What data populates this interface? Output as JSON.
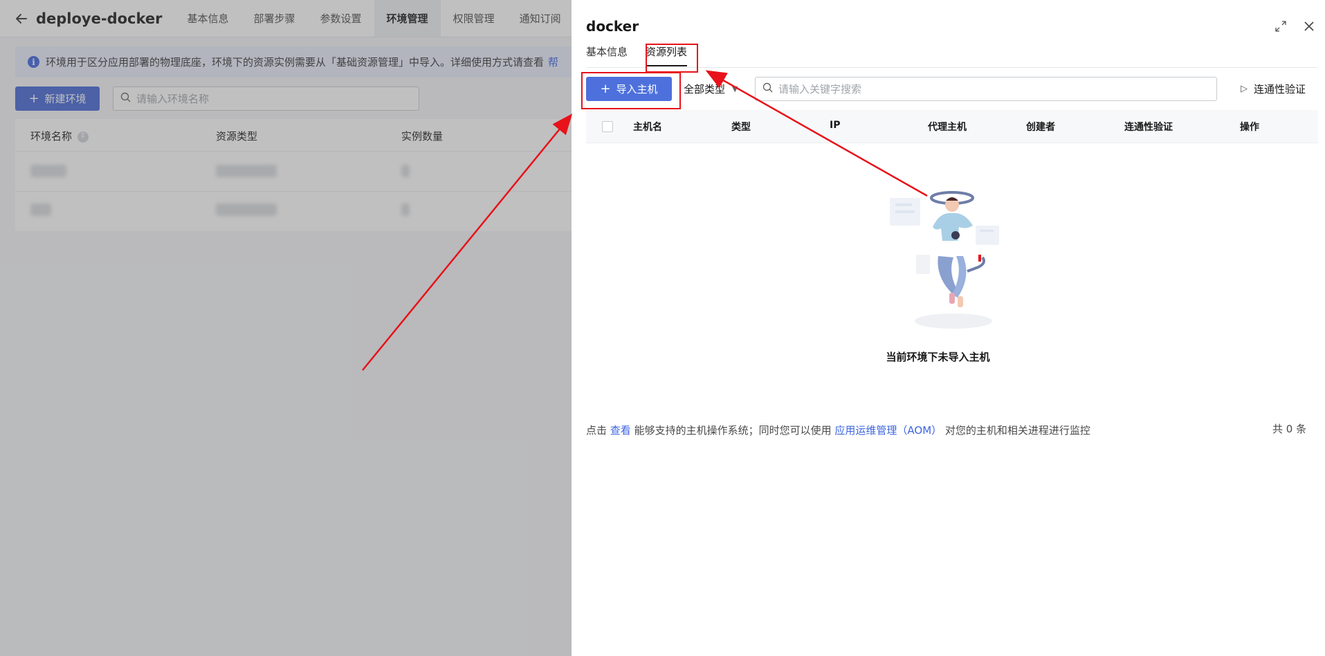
{
  "app": {
    "title": "deploye-docker"
  },
  "top_tabs": [
    {
      "label": "基本信息"
    },
    {
      "label": "部署步骤"
    },
    {
      "label": "参数设置"
    },
    {
      "label": "环境管理"
    },
    {
      "label": "权限管理"
    },
    {
      "label": "通知订阅"
    }
  ],
  "info_bar": {
    "text": "环境用于区分应用部署的物理底座，环境下的资源实例需要从「基础资源管理」中导入。详细使用方式请查看",
    "link": "帮"
  },
  "env_toolbar": {
    "new_env_label": "新建环境",
    "search_placeholder": "请输入环境名称"
  },
  "env_table": {
    "columns": [
      "环境名称",
      "资源类型",
      "实例数量"
    ]
  },
  "drawer": {
    "title": "docker",
    "tabs": [
      {
        "label": "基本信息"
      },
      {
        "label": "资源列表"
      }
    ],
    "import_label": "导入主机",
    "type_select": "全部类型",
    "search_placeholder": "请输入关键字搜索",
    "conn_label": "连通性验证",
    "columns": [
      "主机名",
      "类型",
      "IP",
      "代理主机",
      "创建者",
      "连通性验证",
      "操作"
    ],
    "empty_text": "当前环境下未导入主机",
    "footer": {
      "part1": "点击",
      "link1": "查看",
      "part2": "能够支持的主机操作系统；同时您可以使用",
      "link2": "应用运维管理（AOM）",
      "part3": "对您的主机和相关进程进行监控"
    },
    "total": "共 0 条"
  },
  "colors": {
    "primary": "#4d70dc",
    "link": "#3d64e0",
    "annotation": "#e8121a"
  }
}
